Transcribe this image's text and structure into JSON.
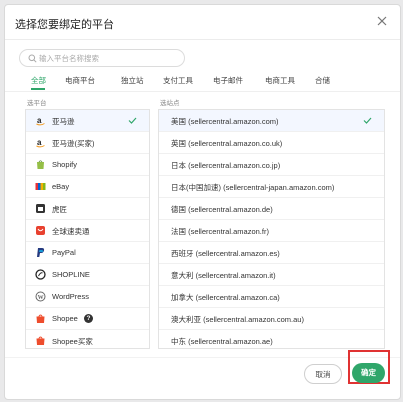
{
  "dialog": {
    "title": "选择您要绑定的平台",
    "search_placeholder": "输入平台名称搜索"
  },
  "tabs": [
    {
      "label": "全部",
      "active": true
    },
    {
      "label": "电商平台"
    },
    {
      "label": "独立站"
    },
    {
      "label": "支付工具"
    },
    {
      "label": "电子邮件"
    },
    {
      "label": "电商工具"
    },
    {
      "label": "合储"
    }
  ],
  "sections": {
    "platform_label": "选平台",
    "site_label": "选站点"
  },
  "platforms": [
    {
      "label": "亚马逊",
      "icon": "amazon-icon",
      "selected": true
    },
    {
      "label": "亚马逊(买家)",
      "icon": "amazon-icon"
    },
    {
      "label": "Shopify",
      "icon": "shopify-icon"
    },
    {
      "label": "eBay",
      "icon": "ebay-icon"
    },
    {
      "label": "虎匠",
      "icon": "store-icon"
    },
    {
      "label": "全球速卖通",
      "icon": "aliexpress-icon"
    },
    {
      "label": "PayPal",
      "icon": "paypal-icon"
    },
    {
      "label": "SHOPLINE",
      "icon": "shopline-icon"
    },
    {
      "label": "WordPress",
      "icon": "wordpress-icon"
    },
    {
      "label": "Shopee",
      "icon": "shopee-icon",
      "help": true
    },
    {
      "label": "Shopee买家",
      "icon": "shopee-icon"
    }
  ],
  "sites": [
    {
      "label": "美国 (sellercentral.amazon.com)",
      "selected": true
    },
    {
      "label": "英国 (sellercentral.amazon.co.uk)"
    },
    {
      "label": "日本 (sellercentral.amazon.co.jp)"
    },
    {
      "label": "日本(中国加速) (sellercentral-japan.amazon.com)"
    },
    {
      "label": "德国 (sellercentral.amazon.de)"
    },
    {
      "label": "法国 (sellercentral.amazon.fr)"
    },
    {
      "label": "西班牙 (sellercentral.amazon.es)"
    },
    {
      "label": "意大利 (sellercentral.amazon.it)"
    },
    {
      "label": "加拿大 (sellercentral.amazon.ca)"
    },
    {
      "label": "澳大利亚 (sellercentral.amazon.com.au)"
    },
    {
      "label": "中东 (sellercentral.amazon.ae)"
    }
  ],
  "buttons": {
    "cancel": "取消",
    "confirm": "确定"
  },
  "colors": {
    "accent": "#2fa66a",
    "highlight": "#e03232",
    "selected_row": "#f3f7ff"
  }
}
